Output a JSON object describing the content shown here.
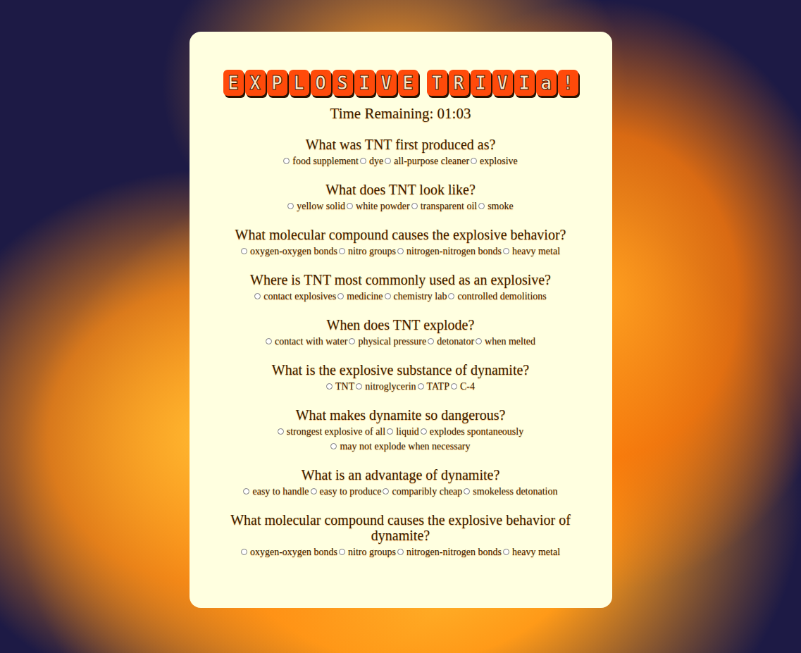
{
  "title": "EXPLOSIVE TRIVIa!",
  "timer": "Time Remaining: 01:03",
  "questions": [
    {
      "text": "What was TNT first produced as?",
      "options": [
        {
          "label": "food supplement",
          "selected": false
        },
        {
          "label": "dye",
          "selected": false
        },
        {
          "label": "all-purpose cleaner",
          "selected": false
        },
        {
          "label": "explosive",
          "selected": false
        }
      ]
    },
    {
      "text": "What does TNT look like?",
      "options": [
        {
          "label": "yellow solid",
          "selected": false
        },
        {
          "label": "white powder",
          "selected": false
        },
        {
          "label": "transparent oil",
          "selected": false
        },
        {
          "label": "smoke",
          "selected": false
        }
      ]
    },
    {
      "text": "What molecular compound causes the explosive behavior?",
      "options": [
        {
          "label": "oxygen-oxygen bonds",
          "selected": false
        },
        {
          "label": "nitro groups",
          "selected": false
        },
        {
          "label": "nitrogen-nitrogen bonds",
          "selected": false
        },
        {
          "label": "heavy metal",
          "selected": false
        }
      ]
    },
    {
      "text": "Where is TNT most commonly used as an explosive?",
      "options": [
        {
          "label": "contact explosives",
          "selected": false
        },
        {
          "label": "medicine",
          "selected": false
        },
        {
          "label": "chemistry lab",
          "selected": false
        },
        {
          "label": "controlled demolitions",
          "selected": false
        }
      ]
    },
    {
      "text": "When does TNT explode?",
      "options": [
        {
          "label": "contact with water",
          "selected": false
        },
        {
          "label": "physical pressure",
          "selected": false
        },
        {
          "label": "detonator",
          "selected": false
        },
        {
          "label": "when melted",
          "selected": false
        }
      ]
    },
    {
      "text": "What is the explosive substance of dynamite?",
      "options": [
        {
          "label": "TNT",
          "selected": false
        },
        {
          "label": "nitroglycerin",
          "selected": false
        },
        {
          "label": "TATP",
          "selected": false
        },
        {
          "label": "C-4",
          "selected": false
        }
      ]
    },
    {
      "text": "What makes dynamite so dangerous?",
      "options": [
        {
          "label": "strongest explosive of all",
          "selected": false
        },
        {
          "label": "liquid",
          "selected": false
        },
        {
          "label": "explodes spontaneously",
          "selected": false
        },
        {
          "label": "may not explode when necessary",
          "selected": false
        }
      ]
    },
    {
      "text": "What is an advantage of dynamite?",
      "options": [
        {
          "label": "easy to handle",
          "selected": false
        },
        {
          "label": "easy to produce",
          "selected": false
        },
        {
          "label": "comparibly cheap",
          "selected": false
        },
        {
          "label": "smokeless detonation",
          "selected": false
        }
      ]
    },
    {
      "text": "What molecular compound causes the explosive behavior of dynamite?",
      "options": [
        {
          "label": "oxygen-oxygen bonds",
          "selected": false
        },
        {
          "label": "nitro groups",
          "selected": false
        },
        {
          "label": "nitrogen-nitrogen bonds",
          "selected": false
        },
        {
          "label": "heavy metal",
          "selected": false
        }
      ]
    }
  ]
}
